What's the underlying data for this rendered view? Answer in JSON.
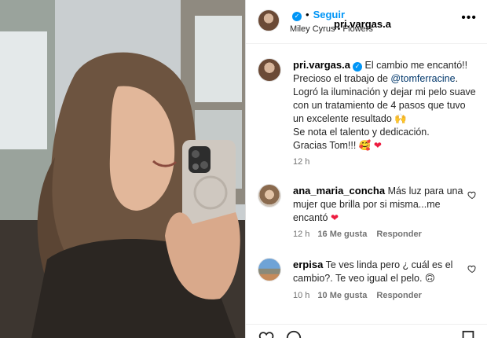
{
  "post": {
    "author": "pri.vargas.a",
    "follow_label": "Seguir",
    "separator": "•",
    "music": "Miley Cyrus • Flowers",
    "more_label": "•••",
    "verified_mark": "✓"
  },
  "caption": {
    "author": "pri.vargas.a",
    "line1": "El cambio me encantó!!",
    "line2_pre": "Precioso el trabajo de ",
    "mention": "@tomferracine",
    "line2_post": ".",
    "line3": "Logró la iluminación y dejar mi pelo suave con un tratamiento de 4 pasos que tuvo un excelente resultado 🙌",
    "line4": "Se nota el talento y dedicación.",
    "line5": "Gracias Tom!!! 🥰",
    "heart": "❤",
    "time": "12 h"
  },
  "comments": [
    {
      "author": "ana_maria_concha",
      "text": "Más luz para una mujer que brilla por si misma...me encantó",
      "heart": "❤",
      "time": "12 h",
      "likes": "16 Me gusta",
      "reply": "Responder"
    },
    {
      "author": "erpisa",
      "text": "Te ves linda pero ¿ cuál es el cambio?. Te veo igual el pelo. 🙃",
      "time": "10 h",
      "likes": "10 Me gusta",
      "reply": "Responder"
    }
  ],
  "icons": {
    "verified": "verified-badge-icon",
    "more": "more-options-icon",
    "like": "heart-outline-icon",
    "comment": "comment-icon",
    "save": "bookmark-icon"
  },
  "colors": {
    "link_blue": "#0095f6",
    "mention_blue": "#00376b",
    "muted": "#737373",
    "heart_red": "#ed1c40"
  }
}
